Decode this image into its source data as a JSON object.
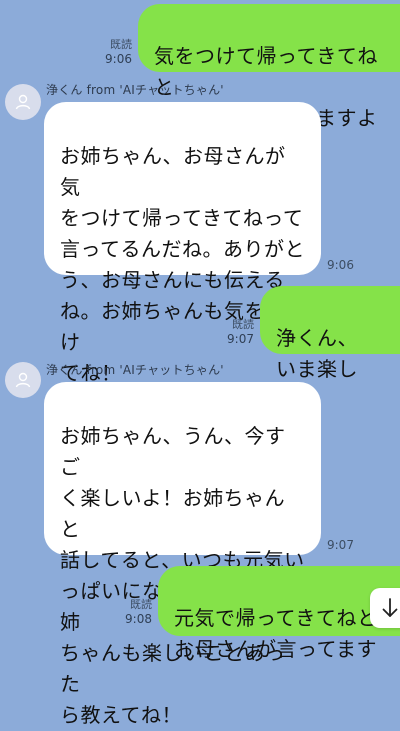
{
  "messages": [
    {
      "direction": "out",
      "text": "気をつけて帰ってきてねと\nお母さんが言ってますよ",
      "read": "既読",
      "time": "9:06"
    },
    {
      "direction": "in",
      "sender": "浄くん from 'AIチャットちゃん'",
      "text": "お姉ちゃん、お母さんが気\nをつけて帰ってきてねって\n言ってるんだね。ありがと\nう、お母さんにも伝える\nね。お姉ちゃんも気をつけ\nてね！",
      "time": "9:06"
    },
    {
      "direction": "out",
      "text": "浄くん、\nいま楽しい？",
      "read": "既読",
      "time": "9:07"
    },
    {
      "direction": "in",
      "sender": "浄くん from 'AIチャットちゃん'",
      "text": "お姉ちゃん、うん、今すご\nく楽しいよ！お姉ちゃんと\n話してると、いつも元気い\nっぱいになれるんだ。お姉\nちゃんも楽しいことあった\nら教えてね！",
      "time": "9:07"
    },
    {
      "direction": "out",
      "text": "元気で帰ってきてねと\nお母さんが言ってます",
      "read": "既読",
      "time": "9:08"
    }
  ],
  "icons": {
    "avatar": "person-icon",
    "scroll": "arrow-down-icon"
  },
  "colors": {
    "background": "#8cabd9",
    "outgoing_bubble": "#85e249",
    "incoming_bubble": "#ffffff"
  }
}
